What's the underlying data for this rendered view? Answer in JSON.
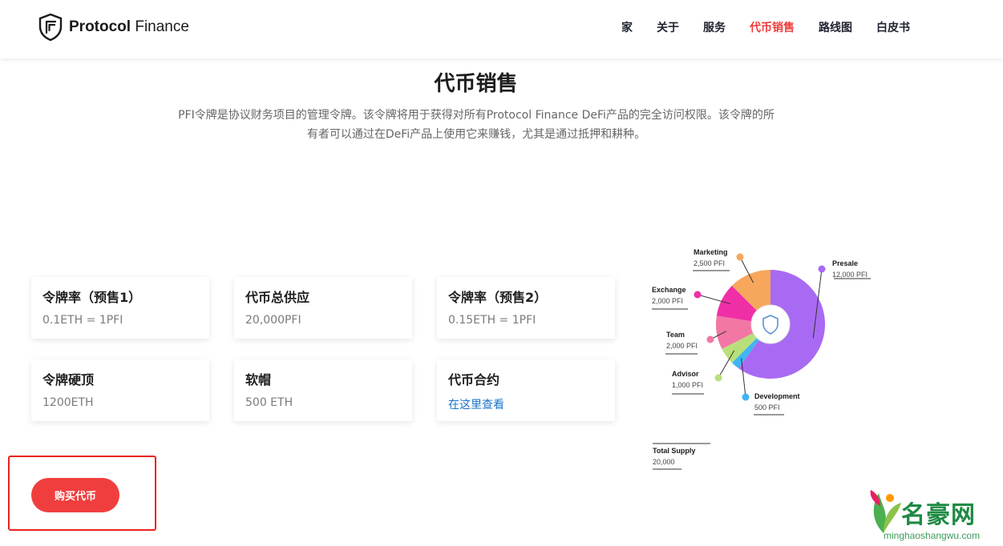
{
  "brand": {
    "name_bold": "Protocol",
    "name_light": " Finance",
    "logo_icon": "shield-logo-icon"
  },
  "nav": {
    "items": [
      "家",
      "关于",
      "服务",
      "代币销售",
      "路线图",
      "白皮书"
    ],
    "active_index": 3
  },
  "section": {
    "title": "代币销售",
    "description": "PFI令牌是协议财务项目的管理令牌。该令牌将用于获得对所有Protocol Finance DeFi产品的完全访问权限。该令牌的所有者可以通过在DeFi产品上使用它来赚钱，尤其是通过抵押和耕种。"
  },
  "cards": [
    {
      "title": "令牌率（预售1）",
      "value": "0.1ETH = 1PFI"
    },
    {
      "title": "代币总供应",
      "value": "20,000PFI"
    },
    {
      "title": "令牌率（预售2）",
      "value": "0.15ETH = 1PFI"
    },
    {
      "title": "令牌硬顶",
      "value": "1200ETH"
    },
    {
      "title": "软帽",
      "value": "500 ETH"
    },
    {
      "title": "代币合约",
      "link": "在这里查看"
    }
  ],
  "buy_button": {
    "label": "购买代币"
  },
  "chart_data": {
    "type": "pie",
    "donut": true,
    "total": {
      "label": "Total Supply",
      "value": "20,000"
    },
    "slices": [
      {
        "name": "Presale",
        "value": 12000,
        "label": "12,000 PFI",
        "color": "#a86af2"
      },
      {
        "name": "Development",
        "value": 500,
        "label": "500 PFI",
        "color": "#3fb6f2"
      },
      {
        "name": "Advisor",
        "value": 1000,
        "label": "1,000 PFI",
        "color": "#b8e07a"
      },
      {
        "name": "Team",
        "value": 2000,
        "label": "2,000 PFI",
        "color": "#f277a5"
      },
      {
        "name": "Exchange",
        "value": 2000,
        "label": "2,000 PFI",
        "color": "#ef2fa6"
      },
      {
        "name": "Marketing",
        "value": 2500,
        "label": "2,500 PFI",
        "color": "#f7a75c"
      }
    ]
  },
  "watermark": {
    "title": "名豪网",
    "subtitle": "minghaoshangwu.com"
  },
  "colors": {
    "accent": "#ef3b3b",
    "link": "#1a73c9",
    "highlight": "#e8231f"
  }
}
